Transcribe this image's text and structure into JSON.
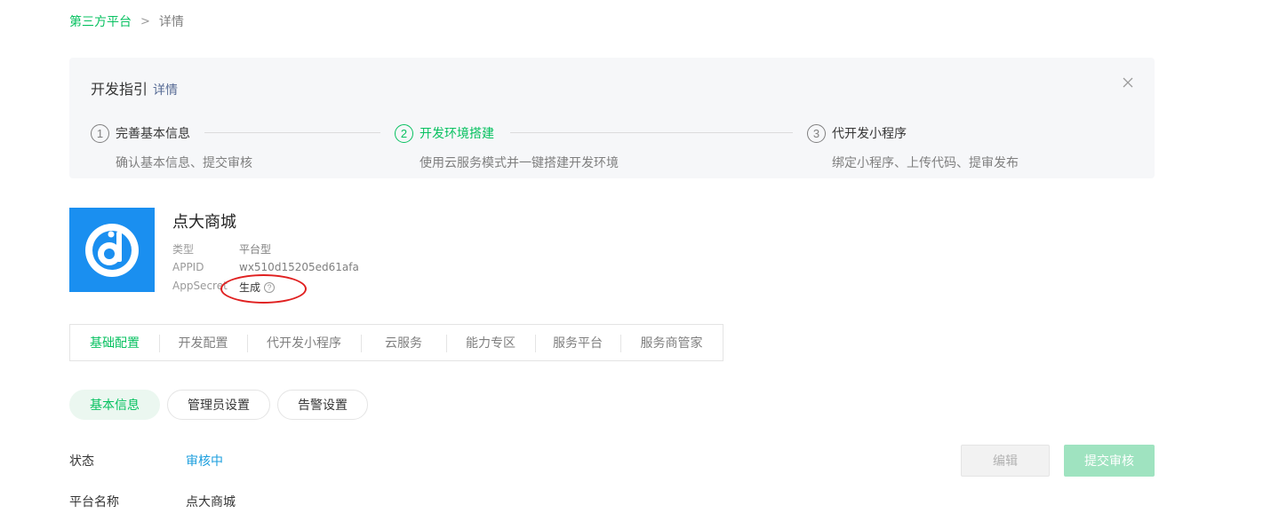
{
  "breadcrumb": {
    "parent": "第三方平台",
    "separator": ">",
    "current": "详情"
  },
  "guide": {
    "title": "开发指引",
    "detail_link": "详情",
    "close_icon": "close-icon",
    "steps": [
      {
        "num": "1",
        "title": "完善基本信息",
        "desc": "确认基本信息、提交审核",
        "active": false
      },
      {
        "num": "2",
        "title": "开发环境搭建",
        "desc": "使用云服务模式并一键搭建开发环境",
        "active": true
      },
      {
        "num": "3",
        "title": "代开发小程序",
        "desc": "绑定小程序、上传代码、提审发布",
        "active": false
      }
    ]
  },
  "app": {
    "name": "点大商城",
    "logo_icon": "app-logo-icon",
    "logo_color": "#1a8ff0",
    "type_label": "类型",
    "type_value": "平台型",
    "appid_label": "APPID",
    "appid_value": "wx510d15205ed61afa",
    "secret_label": "AppSecret",
    "secret_value": "生成",
    "help_icon": "?"
  },
  "tabs": [
    {
      "label": "基础配置",
      "active": true
    },
    {
      "label": "开发配置"
    },
    {
      "label": "代开发小程序"
    },
    {
      "label": "云服务"
    },
    {
      "label": "能力专区"
    },
    {
      "label": "服务平台"
    },
    {
      "label": "服务商管家"
    }
  ],
  "subtabs": [
    {
      "label": "基本信息",
      "active": true
    },
    {
      "label": "管理员设置"
    },
    {
      "label": "告警设置"
    }
  ],
  "fields": {
    "status_label": "状态",
    "status_value": "审核中",
    "platform_label": "平台名称",
    "platform_value": "点大商城"
  },
  "actions": {
    "edit": "编辑",
    "submit": "提交审核"
  },
  "colors": {
    "accent": "#07c160",
    "link": "#576b95",
    "status": "#1b9ede",
    "annotation": "#e02020"
  }
}
